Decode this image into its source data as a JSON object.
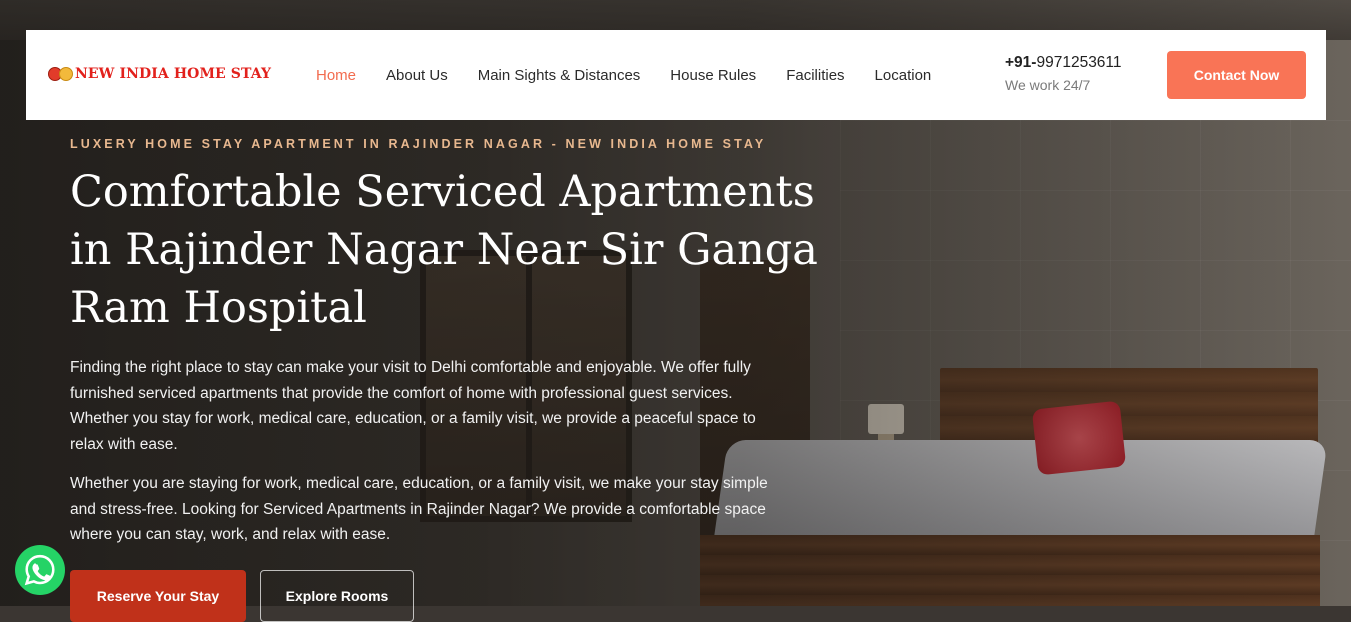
{
  "brand": {
    "name": "NEW INDIA HOME STAY",
    "logo_icon": "emoji-faces-icon"
  },
  "nav": {
    "items": [
      {
        "label": "Home",
        "active": true
      },
      {
        "label": "About Us",
        "active": false
      },
      {
        "label": "Main Sights & Distances",
        "active": false
      },
      {
        "label": "House Rules",
        "active": false
      },
      {
        "label": "Facilities",
        "active": false
      },
      {
        "label": "Location",
        "active": false
      }
    ]
  },
  "contact": {
    "phone_prefix": "+91-",
    "phone_number": "9971253611",
    "hours": "We work 24/7",
    "button_label": "Contact Now"
  },
  "hero": {
    "eyebrow": "LUXERY HOME STAY APARTMENT IN RAJINDER NAGAR - NEW INDIA HOME STAY",
    "title": "Comfortable Serviced Apartments in Rajinder Nagar Near Sir Ganga Ram Hospital",
    "paragraph_1": "Finding the right place to stay can make your visit to Delhi comfortable and enjoyable. We offer fully furnished serviced apartments that provide the comfort of home with professional guest services. Whether you stay for work, medical care, education, or a family visit, we provide a peaceful space to relax with ease.",
    "paragraph_2": "Whether you are staying for work, medical care, education, or a family visit, we make your stay simple and stress-free. Looking for Serviced Apartments in Rajinder Nagar? We provide a comfortable space where you can stay, work, and relax with ease.",
    "primary_button": "Reserve Your Stay",
    "secondary_button": "Explore Rooms"
  },
  "floating": {
    "whatsapp_icon": "whatsapp-icon"
  },
  "colors": {
    "accent": "#f97456",
    "active_nav": "#f26c4f",
    "reserve_button": "#c0311a",
    "brand_red": "#e2211c",
    "eyebrow": "#e8b88f",
    "whatsapp": "#25d366"
  }
}
